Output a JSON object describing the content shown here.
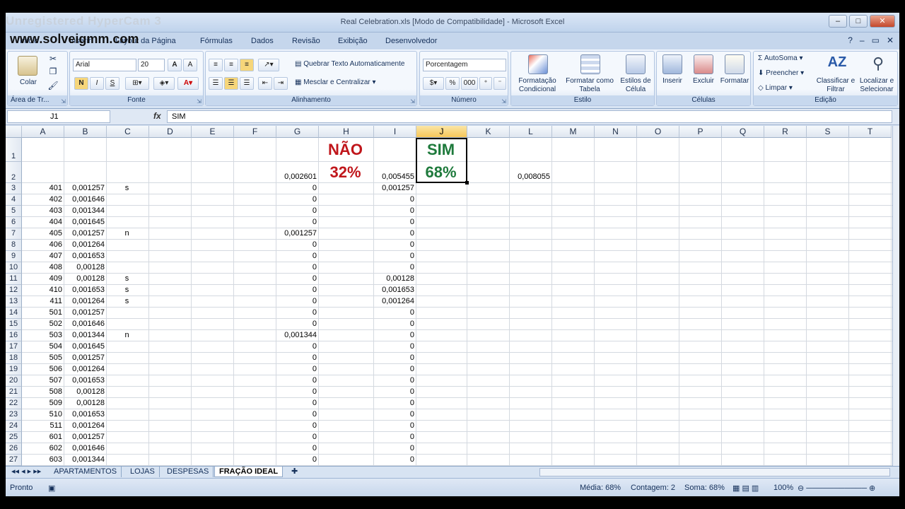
{
  "watermark": {
    "line1": "Unregistered HyperCam 3",
    "line2": "www.solveigmm.com"
  },
  "window": {
    "title": "Real Celebration.xls  [Modo de Compatibilidade] - Microsoft Excel",
    "minimize": "–",
    "maximize": "□",
    "close": "✕"
  },
  "tabs": [
    "Início",
    "Inserir",
    "Layout da Página",
    "Fórmulas",
    "Dados",
    "Revisão",
    "Exibição",
    "Desenvolvedor"
  ],
  "ribbon": {
    "clipboard": {
      "paste": "Colar",
      "label": "Área de Tr..."
    },
    "font": {
      "name": "Arial",
      "size": "20",
      "bold": "N",
      "italic": "I",
      "underline": "S",
      "label": "Fonte"
    },
    "alignment": {
      "wrap": "Quebrar Texto Automaticamente",
      "merge": "Mesclar e Centralizar",
      "label": "Alinhamento"
    },
    "number": {
      "format": "Porcentagem",
      "percent": "%",
      "thousands": "000",
      "label": "Número"
    },
    "styles": {
      "conditional": "Formatação Condicional",
      "table": "Formatar como Tabela",
      "cell": "Estilos de Célula",
      "label": "Estilo"
    },
    "cells": {
      "insert": "Inserir",
      "delete": "Excluir",
      "format": "Formatar",
      "label": "Células"
    },
    "editing": {
      "autosum": "AutoSoma",
      "fill": "Preencher",
      "clear": "Limpar",
      "sort": "Classificar e Filtrar",
      "find": "Localizar e Selecionar",
      "label": "Edição"
    }
  },
  "formula_bar": {
    "name_box": "J1",
    "fx": "fx",
    "content": "SIM"
  },
  "columns": [
    "A",
    "B",
    "C",
    "D",
    "E",
    "F",
    "G",
    "H",
    "I",
    "J",
    "K",
    "L",
    "M",
    "N",
    "O",
    "P",
    "Q",
    "R",
    "S",
    "T"
  ],
  "rows": [
    {
      "n": "1",
      "A": "",
      "B": "",
      "C": "",
      "G": "",
      "H": "NÃO",
      "I": "",
      "J": "SIM",
      "L": ""
    },
    {
      "n": "2",
      "A": "",
      "B": "",
      "C": "",
      "G": "0,002601",
      "H": "32%",
      "I": "0,005455",
      "J": "68%",
      "L": "0,008055"
    },
    {
      "n": "3",
      "A": "401",
      "B": "0,001257",
      "C": "s",
      "G": "0",
      "I": "0,001257"
    },
    {
      "n": "4",
      "A": "402",
      "B": "0,001646",
      "C": "",
      "G": "0",
      "I": "0"
    },
    {
      "n": "5",
      "A": "403",
      "B": "0,001344",
      "C": "",
      "G": "0",
      "I": "0"
    },
    {
      "n": "6",
      "A": "404",
      "B": "0,001645",
      "C": "",
      "G": "0",
      "I": "0"
    },
    {
      "n": "7",
      "A": "405",
      "B": "0,001257",
      "C": "n",
      "G": "0,001257",
      "I": "0"
    },
    {
      "n": "8",
      "A": "406",
      "B": "0,001264",
      "C": "",
      "G": "0",
      "I": "0"
    },
    {
      "n": "9",
      "A": "407",
      "B": "0,001653",
      "C": "",
      "G": "0",
      "I": "0"
    },
    {
      "n": "10",
      "A": "408",
      "B": "0,00128",
      "C": "",
      "G": "0",
      "I": "0"
    },
    {
      "n": "11",
      "A": "409",
      "B": "0,00128",
      "C": "s",
      "G": "0",
      "I": "0,00128"
    },
    {
      "n": "12",
      "A": "410",
      "B": "0,001653",
      "C": "s",
      "G": "0",
      "I": "0,001653"
    },
    {
      "n": "13",
      "A": "411",
      "B": "0,001264",
      "C": "s",
      "G": "0",
      "I": "0,001264"
    },
    {
      "n": "14",
      "A": "501",
      "B": "0,001257",
      "C": "",
      "G": "0",
      "I": "0"
    },
    {
      "n": "15",
      "A": "502",
      "B": "0,001646",
      "C": "",
      "G": "0",
      "I": "0"
    },
    {
      "n": "16",
      "A": "503",
      "B": "0,001344",
      "C": "n",
      "G": "0,001344",
      "I": "0"
    },
    {
      "n": "17",
      "A": "504",
      "B": "0,001645",
      "C": "",
      "G": "0",
      "I": "0"
    },
    {
      "n": "18",
      "A": "505",
      "B": "0,001257",
      "C": "",
      "G": "0",
      "I": "0"
    },
    {
      "n": "19",
      "A": "506",
      "B": "0,001264",
      "C": "",
      "G": "0",
      "I": "0"
    },
    {
      "n": "20",
      "A": "507",
      "B": "0,001653",
      "C": "",
      "G": "0",
      "I": "0"
    },
    {
      "n": "21",
      "A": "508",
      "B": "0,00128",
      "C": "",
      "G": "0",
      "I": "0"
    },
    {
      "n": "22",
      "A": "509",
      "B": "0,00128",
      "C": "",
      "G": "0",
      "I": "0"
    },
    {
      "n": "23",
      "A": "510",
      "B": "0,001653",
      "C": "",
      "G": "0",
      "I": "0"
    },
    {
      "n": "24",
      "A": "511",
      "B": "0,001264",
      "C": "",
      "G": "0",
      "I": "0"
    },
    {
      "n": "25",
      "A": "601",
      "B": "0,001257",
      "C": "",
      "G": "0",
      "I": "0"
    },
    {
      "n": "26",
      "A": "602",
      "B": "0,001646",
      "C": "",
      "G": "0",
      "I": "0"
    },
    {
      "n": "27",
      "A": "603",
      "B": "0,001344",
      "C": "",
      "G": "0",
      "I": "0"
    }
  ],
  "sheets": [
    "APARTAMENTOS",
    "LOJAS",
    "DESPESAS",
    "FRAÇÃO IDEAL"
  ],
  "active_sheet": "FRAÇÃO IDEAL",
  "status": {
    "ready": "Pronto",
    "average": "Média: 68%",
    "count": "Contagem: 2",
    "sum": "Soma: 68%",
    "zoom": "100%"
  },
  "colors": {
    "nao": "#c0161b",
    "sim": "#1e7a3c",
    "selection": "#f6c659"
  }
}
